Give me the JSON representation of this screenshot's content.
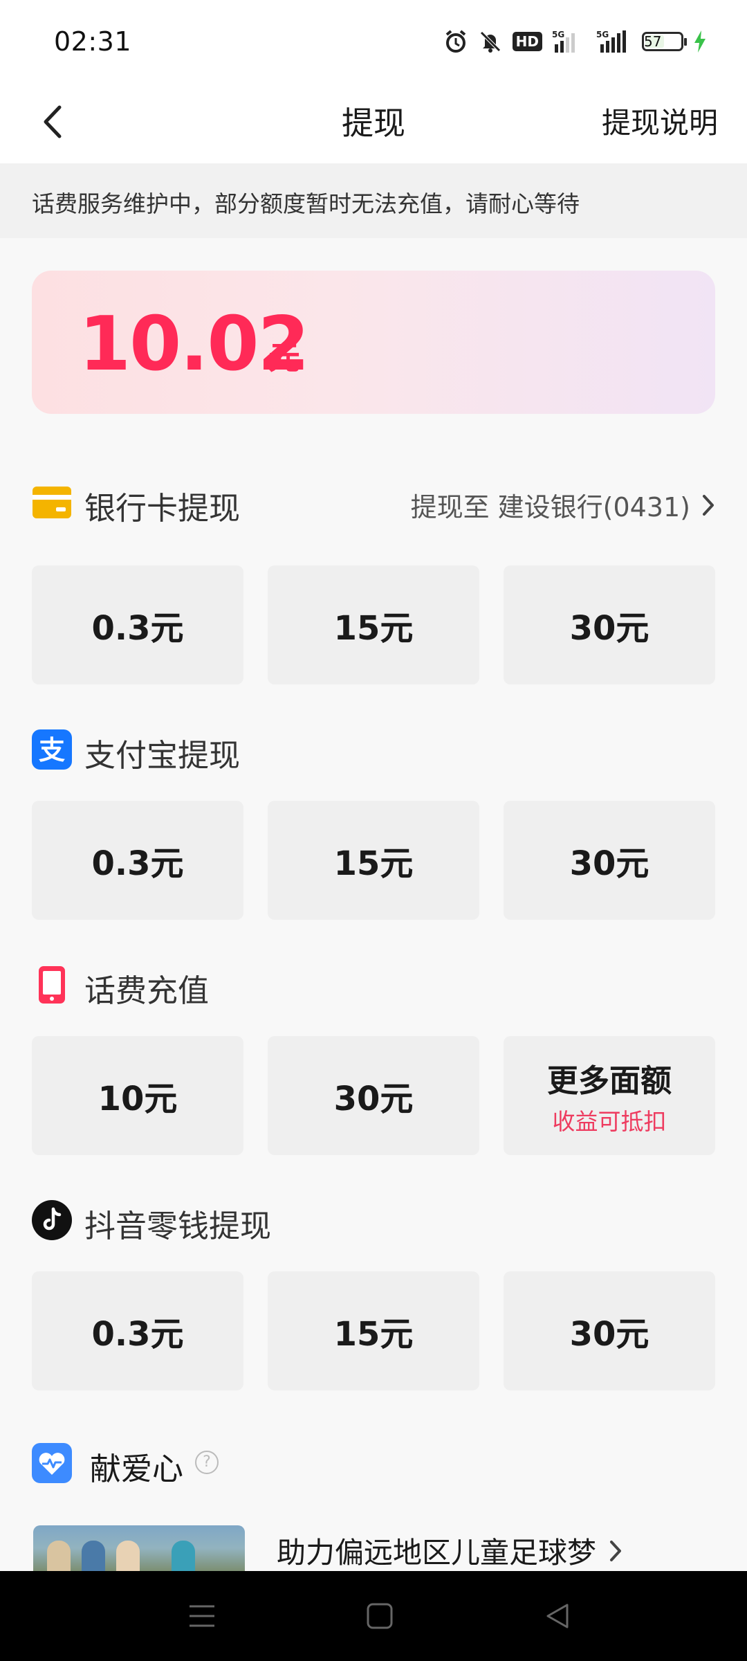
{
  "status_bar": {
    "time": "02:31",
    "hd_label": "HD",
    "net1": "5G",
    "net2": "5G",
    "battery": "57",
    "battery_level": 57,
    "charging": true
  },
  "nav": {
    "title": "提现",
    "right_link": "提现说明"
  },
  "notice": "话费服务维护中，部分额度暂时无法充值，请耐心等待",
  "balance": {
    "amount": "10.02",
    "unit": "元"
  },
  "sections": {
    "bank": {
      "title": "银行卡提现",
      "target": "提现至 建设银行(0431)",
      "options": [
        "0.3元",
        "15元",
        "30元"
      ]
    },
    "alipay": {
      "title": "支付宝提现",
      "options": [
        "0.3元",
        "15元",
        "30元"
      ]
    },
    "phone": {
      "title": "话费充值",
      "options": [
        "10元",
        "30元",
        "更多面额"
      ],
      "more_sub": "收益可抵扣"
    },
    "douyin": {
      "title": "抖音零钱提现",
      "options": [
        "0.3元",
        "15元",
        "30元"
      ]
    },
    "donate": {
      "title": "献爱心",
      "help": "?",
      "item_title": "助力偏远地区儿童足球梦"
    }
  },
  "colors": {
    "accent": "#ff2a57",
    "bank_icon": "#f4b400",
    "alipay_icon": "#1677ff",
    "phone_icon": "#ff3358",
    "donate_icon": "#3d8bff"
  }
}
